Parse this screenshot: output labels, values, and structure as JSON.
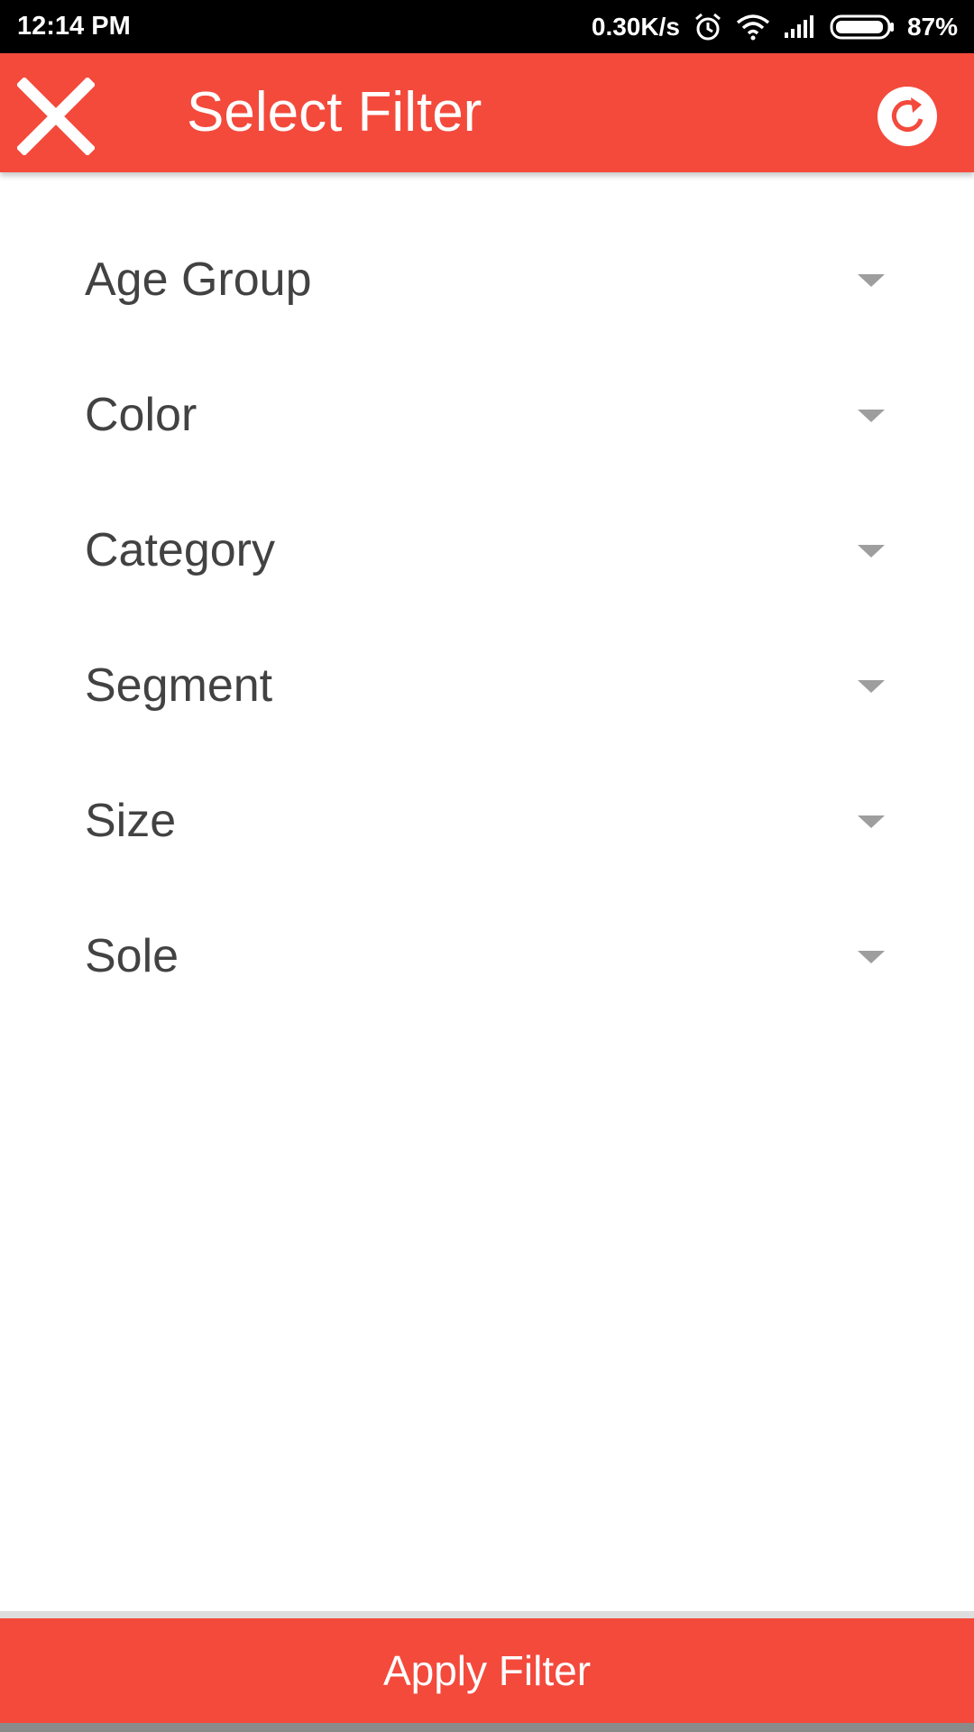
{
  "status_bar": {
    "time": "12:14 PM",
    "network_speed": "0.30K/s",
    "battery": "87%",
    "icons": [
      "alarm-icon",
      "wifi-icon",
      "signal-icon",
      "battery-icon"
    ]
  },
  "app_bar": {
    "title": "Select Filter",
    "close_icon": "close-icon",
    "reset_icon": "refresh-icon"
  },
  "filters": [
    {
      "label": "Age Group"
    },
    {
      "label": "Color"
    },
    {
      "label": "Category"
    },
    {
      "label": "Segment"
    },
    {
      "label": "Size"
    },
    {
      "label": "Sole"
    }
  ],
  "apply_button": {
    "label": "Apply Filter"
  },
  "colors": {
    "accent": "#f34a3c",
    "text": "#424242",
    "arrow": "#9e9e9e",
    "status_bar": "#000000"
  }
}
